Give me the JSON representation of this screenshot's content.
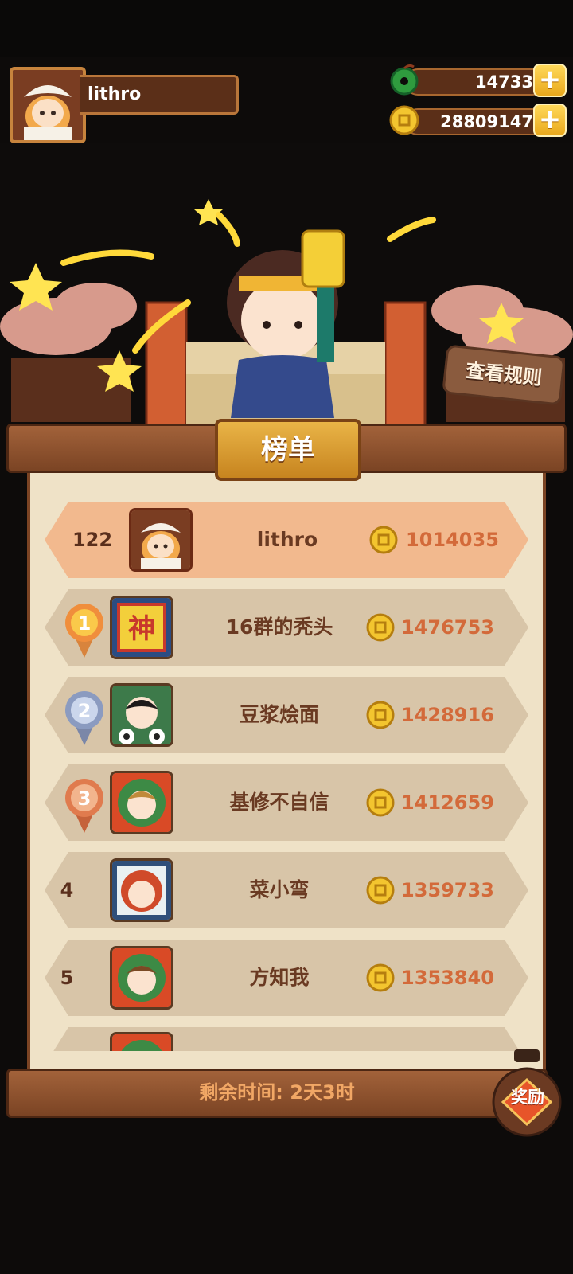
{
  "player": {
    "name": "lithro"
  },
  "currency": {
    "gems": "14733",
    "coins": "28809147"
  },
  "rules_button": "查看规则",
  "board": {
    "title": "榜单",
    "self_row": {
      "rank": "122",
      "name": "lithro",
      "score": "1014035"
    },
    "rows": [
      {
        "rank": "1",
        "name": "16群的秃头",
        "score": "1476753"
      },
      {
        "rank": "2",
        "name": "豆浆烩面",
        "score": "1428916"
      },
      {
        "rank": "3",
        "name": "基修不自信",
        "score": "1412659"
      },
      {
        "rank": "4",
        "name": "菜小弯",
        "score": "1359733"
      },
      {
        "rank": "5",
        "name": "方知我",
        "score": "1353840"
      }
    ],
    "avatar_glyph_1": "神"
  },
  "footer": {
    "time_left": "剩余时间: 2天3时"
  },
  "reward_button": "奖励",
  "colors": {
    "accent": "#e9b447",
    "panel": "#efe2c7",
    "score": "#d36a3a"
  }
}
